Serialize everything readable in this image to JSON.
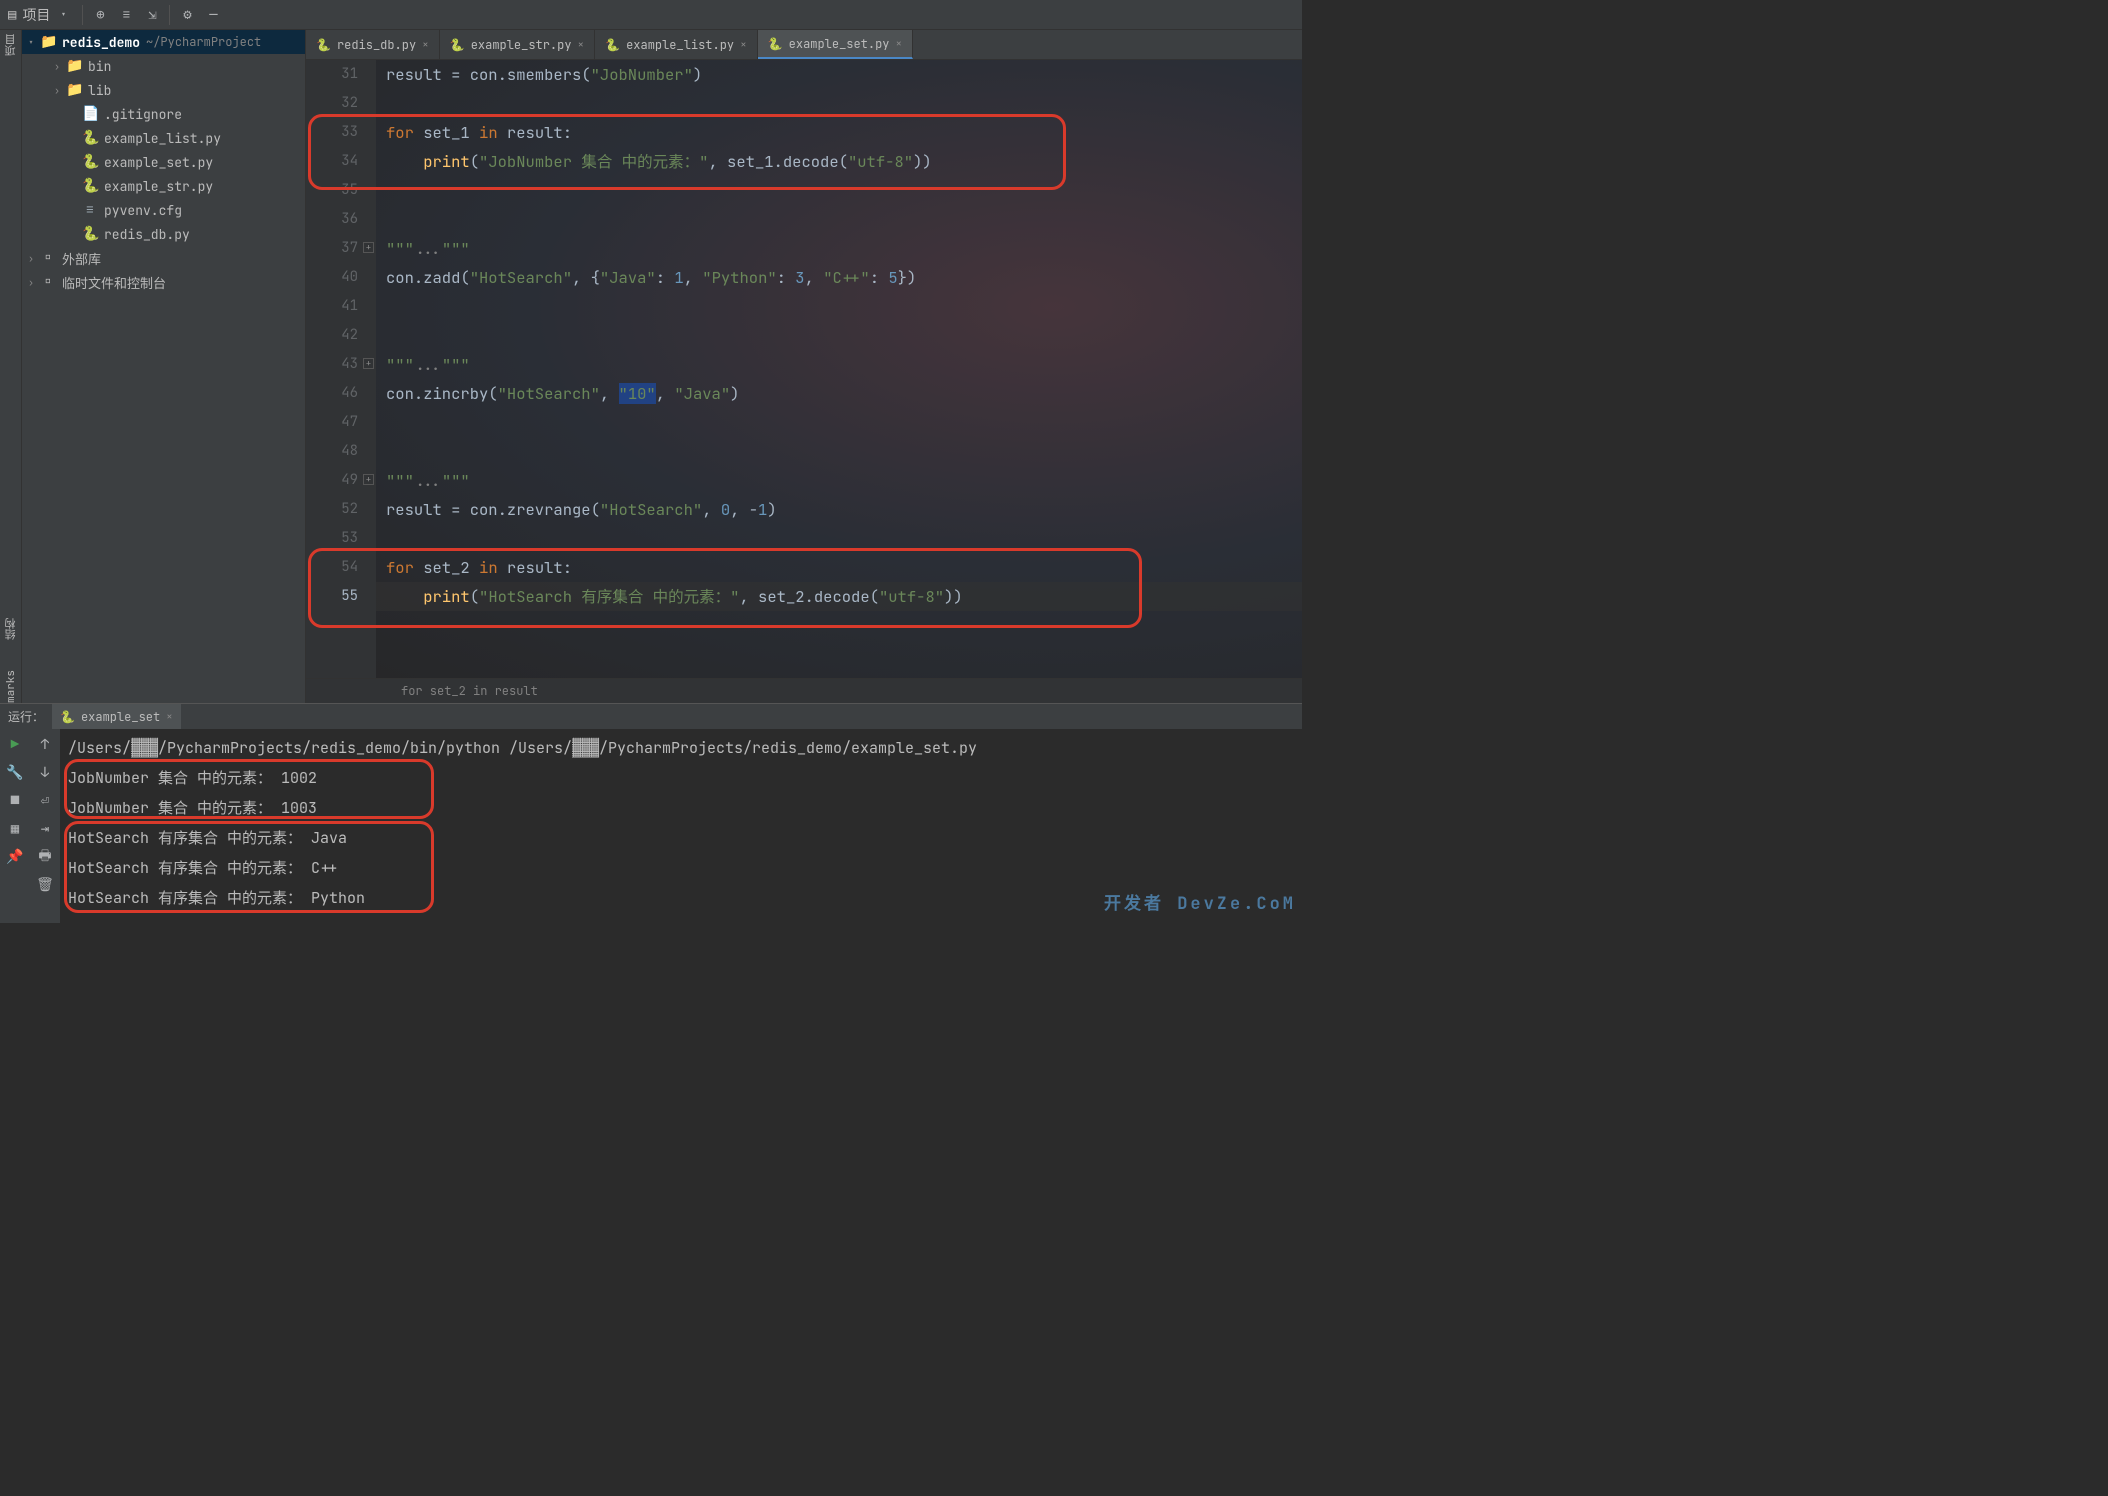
{
  "toolbar": {
    "project_label": "项目"
  },
  "vtabs_left": [
    "项目",
    "结构",
    "marks"
  ],
  "tree": {
    "root": {
      "name": "redis_demo",
      "suffix": "~/PycharmProject"
    },
    "items": [
      {
        "name": "bin",
        "icon": "folder",
        "indent": 2,
        "arrow": "›"
      },
      {
        "name": "lib",
        "icon": "folder",
        "indent": 2,
        "arrow": "›"
      },
      {
        "name": ".gitignore",
        "icon": "file",
        "indent": 3
      },
      {
        "name": "example_list.py",
        "icon": "python",
        "indent": 3
      },
      {
        "name": "example_set.py",
        "icon": "python",
        "indent": 3
      },
      {
        "name": "example_str.py",
        "icon": "python",
        "indent": 3
      },
      {
        "name": "pyvenv.cfg",
        "icon": "cfg",
        "indent": 3
      },
      {
        "name": "redis_db.py",
        "icon": "python",
        "indent": 3
      }
    ],
    "extras": [
      {
        "name": "外部库",
        "arrow": "›"
      },
      {
        "name": "临时文件和控制台",
        "arrow": "›"
      }
    ]
  },
  "tabs": [
    {
      "label": "redis_db.py",
      "active": false
    },
    {
      "label": "example_str.py",
      "active": false
    },
    {
      "label": "example_list.py",
      "active": false
    },
    {
      "label": "example_set.py",
      "active": true
    }
  ],
  "code": {
    "lines": [
      {
        "n": "31",
        "html": "result = con.smembers(<span class='str'>\"JobNumber\"</span>)"
      },
      {
        "n": "32",
        "html": ""
      },
      {
        "n": "33",
        "html": "<span class='kw'>for</span> set_1 <span class='kw'>in</span> result:"
      },
      {
        "n": "34",
        "html": "    <span class='fn'>print</span>(<span class='str'>\"JobNumber 集合 中的元素：\"</span>, set_1.decode(<span class='str'>\"utf-8\"</span>))"
      },
      {
        "n": "35",
        "html": ""
      },
      {
        "n": "36",
        "html": ""
      },
      {
        "n": "37",
        "html": "<span class='str'>\"\"\"</span><span class='cmt'>...</span><span class='str'>\"\"\"</span>",
        "fold": true
      },
      {
        "n": "40",
        "html": "con.zadd(<span class='str'>\"HotSearch\"</span>, {<span class='str'>\"Java\"</span>: <span class='num'>1</span>, <span class='str'>\"Python\"</span>: <span class='num'>3</span>, <span class='str'>\"C++\"</span>: <span class='num'>5</span>})"
      },
      {
        "n": "41",
        "html": ""
      },
      {
        "n": "42",
        "html": ""
      },
      {
        "n": "43",
        "html": "<span class='str'>\"\"\"</span><span class='cmt'>...</span><span class='str'>\"\"\"</span>",
        "fold": true
      },
      {
        "n": "46",
        "html": "con.zincrby(<span class='str'>\"HotSearch\"</span>, <span class='hi'><span class='str'>\"10\"</span></span>, <span class='str'>\"Java\"</span>)"
      },
      {
        "n": "47",
        "html": ""
      },
      {
        "n": "48",
        "html": ""
      },
      {
        "n": "49",
        "html": "<span class='str'>\"\"\"</span><span class='cmt'>...</span><span class='str'>\"\"\"</span>",
        "fold": true
      },
      {
        "n": "52",
        "html": "result = con.zrevrange(<span class='str'>\"HotSearch\"</span>, <span class='num'>0</span>, -<span class='num'>1</span>)"
      },
      {
        "n": "53",
        "html": ""
      },
      {
        "n": "54",
        "html": "<span class='kw'>for</span> set_2 <span class='kw'>in</span> result:"
      },
      {
        "n": "55",
        "html": "    <span class='fn'>print</span>(<span class='str'>\"HotSearch 有序集合 中的元素：\"</span>, set_2.decode(<span class='str'>\"utf-8\"</span>))",
        "cur": true
      },
      {
        "n": "",
        "html": ""
      }
    ],
    "breadcrumb": "for set_2 in result"
  },
  "run": {
    "label": "运行：",
    "tab": "example_set",
    "cmd": "/Users/▓▓▓/PycharmProjects/redis_demo/bin/python /Users/▓▓▓/PycharmProjects/redis_demo/example_set.py",
    "out": [
      "JobNumber 集合 中的元素： 1002",
      "JobNumber 集合 中的元素： 1003",
      "HotSearch 有序集合 中的元素： Java",
      "HotSearch 有序集合 中的元素： C++",
      "HotSearch 有序集合 中的元素： Python"
    ]
  },
  "watermark": "开发者 DevZe.CoM"
}
